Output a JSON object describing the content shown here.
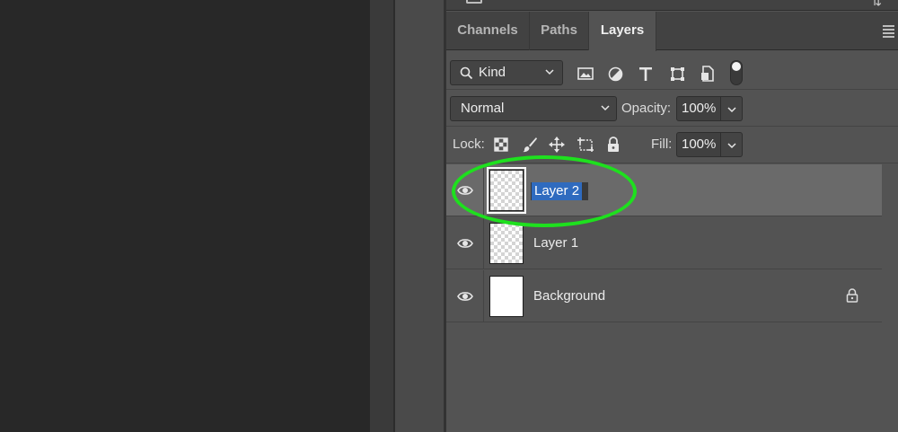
{
  "panel": {
    "tabs": [
      {
        "label": "Channels",
        "active": false
      },
      {
        "label": "Paths",
        "active": false
      },
      {
        "label": "Layers",
        "active": true
      }
    ]
  },
  "filter": {
    "kind_label": "Kind",
    "icons": [
      "image-filter-icon",
      "adjustment-filter-icon",
      "type-filter-icon",
      "shape-filter-icon",
      "smart-object-filter-icon"
    ]
  },
  "blend": {
    "mode": "Normal",
    "opacity_label": "Opacity:",
    "opacity_value": "100%"
  },
  "lock": {
    "label": "Lock:",
    "fill_label": "Fill:",
    "fill_value": "100%"
  },
  "layers": [
    {
      "name": "Layer 2",
      "selected": true,
      "editing": true,
      "visible": true,
      "thumbnail": "transparent",
      "locked": false
    },
    {
      "name": "Layer 1",
      "selected": false,
      "editing": false,
      "visible": true,
      "thumbnail": "transparent",
      "locked": false
    },
    {
      "name": "Background",
      "selected": false,
      "editing": false,
      "visible": true,
      "thumbnail": "white",
      "locked": true
    }
  ],
  "annotation": {
    "color": "#1ee01e"
  },
  "colors": {
    "selection": "#2f6bbf",
    "panel": "#535353",
    "canvas": "#282828"
  }
}
